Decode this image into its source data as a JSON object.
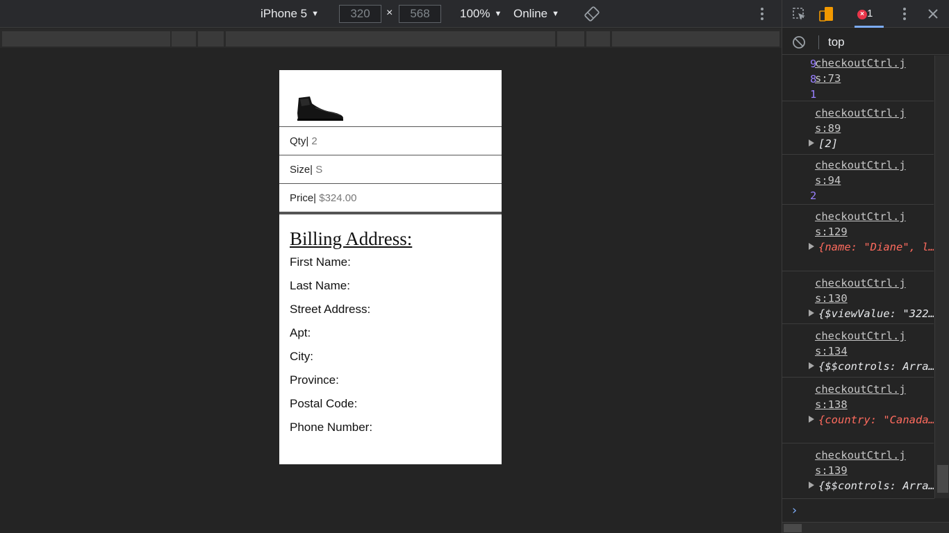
{
  "toolbar": {
    "device": "iPhone 5",
    "width": "320",
    "height": "568",
    "times": "×",
    "zoom": "100%",
    "network": "Online"
  },
  "product": {
    "image_alt": "black leather ankle boot",
    "qty_label": "Qty|",
    "qty_value": " 2",
    "size_label": "Size|",
    "size_value": " S",
    "price_label": "Price|",
    "price_value": " $324.00"
  },
  "billing": {
    "title": "Billing Address:",
    "fields": [
      "First Name:",
      "Last Name:",
      "Street Address:",
      "Apt:",
      "City:",
      "Province:",
      "Postal Code:",
      "Phone Number:"
    ]
  },
  "devtools": {
    "error_count": "1",
    "context": "top",
    "entries": [
      {
        "source": "checkoutCtrl.js:73",
        "value": "981"
      },
      {
        "source": "checkoutCtrl.js:89",
        "value": "[2]"
      },
      {
        "source": "checkoutCtrl.js:94",
        "value": "2"
      },
      {
        "source": "checkoutCtrl.js:129",
        "value": "{name: \"Diane\", l… Richards St.\", st…"
      },
      {
        "source": "checkoutCtrl.js:130",
        "value": "{$viewValue: \"322…"
      },
      {
        "source": "checkoutCtrl.js:134",
        "value": "{$$controls: Arra…"
      },
      {
        "source": "checkoutCtrl.js:138",
        "value": "{country: \"Canada… Richards St.\", …}"
      },
      {
        "source": "checkoutCtrl.js:139",
        "value": "{$$controls: Arra…"
      }
    ]
  },
  "colors": {
    "accent": "#7cacf8",
    "error": "#e8364a",
    "string": "#ff6b5e",
    "number": "#9980ff"
  }
}
